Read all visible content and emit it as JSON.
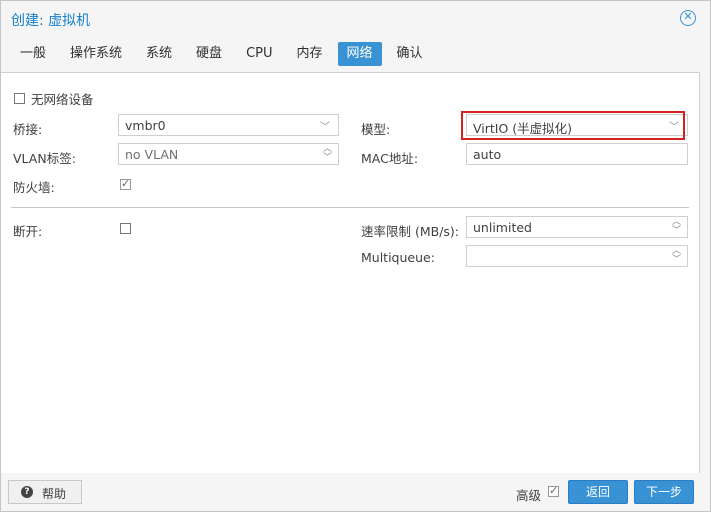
{
  "dialog": {
    "title": "创建: 虚拟机"
  },
  "tabs": [
    {
      "label": "一般"
    },
    {
      "label": "操作系统"
    },
    {
      "label": "系统"
    },
    {
      "label": "硬盘"
    },
    {
      "label": "CPU"
    },
    {
      "label": "内存"
    },
    {
      "label": "网络",
      "active": true
    },
    {
      "label": "确认"
    }
  ],
  "form": {
    "no_network_label": "无网络设备",
    "bridge_label": "桥接:",
    "bridge_value": "vmbr0",
    "vlan_label": "VLAN标签:",
    "vlan_value": "no VLAN",
    "firewall_label": "防火墙:",
    "firewall_checked": true,
    "model_label": "模型:",
    "model_value": "VirtIO (半虚拟化)",
    "mac_label": "MAC地址:",
    "mac_value": "auto",
    "disconnect_label": "断开:",
    "disconnect_checked": false,
    "rate_label": "速率限制 (MB/s):",
    "rate_value": "unlimited",
    "multiqueue_label": "Multiqueue:",
    "multiqueue_value": ""
  },
  "footer": {
    "help_label": "帮助",
    "advanced_label": "高级",
    "advanced_checked": true,
    "back_label": "返回",
    "next_label": "下一步"
  },
  "colors": {
    "accent": "#3892d3",
    "highlight": "#d4231f"
  }
}
